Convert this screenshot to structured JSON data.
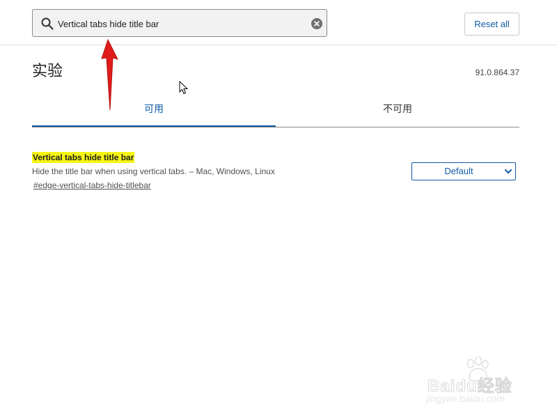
{
  "search": {
    "value": "Vertical tabs hide title bar",
    "icon": "search-icon",
    "clear_icon": "clear-icon"
  },
  "header": {
    "reset_label": "Reset all"
  },
  "main": {
    "title": "实验",
    "version": "91.0.864.37",
    "tabs": [
      {
        "label": "可用",
        "active": true
      },
      {
        "label": "不可用",
        "active": false
      }
    ]
  },
  "flags": [
    {
      "name": "Vertical tabs hide title bar",
      "description": "Hide the title bar when using vertical tabs. – Mac, Windows, Linux",
      "link": "#edge-vertical-tabs-hide-titlebar",
      "selected": "Default"
    }
  ],
  "colors": {
    "accent": "#0f5aa6",
    "highlight": "#f5f514",
    "annotation_arrow": "#e01b1b"
  },
  "watermark": {
    "brand": "Baidu经验",
    "url": "jingyan.baidu.com"
  }
}
